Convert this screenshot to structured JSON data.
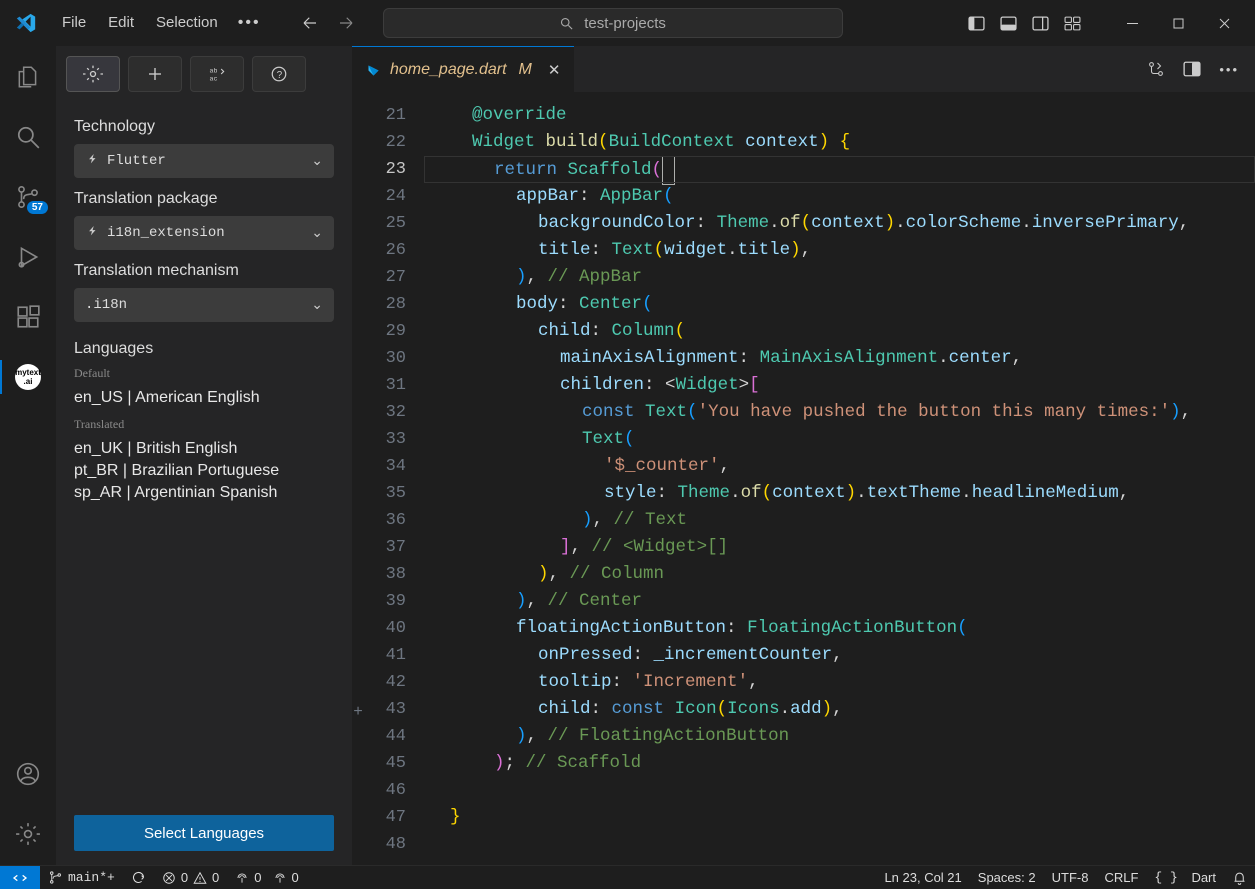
{
  "titlebar": {
    "menus": [
      "File",
      "Edit",
      "Selection"
    ],
    "search_placeholder": "test-projects"
  },
  "activitybar": {
    "scm_badge": "57",
    "mytext_label": "mytext\n.ai"
  },
  "sidebar": {
    "sections": {
      "technology_label": "Technology",
      "technology_value": "Flutter",
      "package_label": "Translation package",
      "package_value": "i18n_extension",
      "mechanism_label": "Translation mechanism",
      "mechanism_value": ".i18n"
    },
    "languages_header": "Languages",
    "default_label": "Default",
    "default_items": [
      "en_US | American English"
    ],
    "translated_label": "Translated",
    "translated_items": [
      "en_UK | British English",
      "pt_BR | Brazilian Portuguese",
      "sp_AR | Argentinian Spanish"
    ],
    "select_button": "Select Languages"
  },
  "editor": {
    "tab_filename": "home_page.dart",
    "tab_modified": "M",
    "line_start": 21,
    "line_end": 48,
    "current_line": 23,
    "decorated_plus_line": 43,
    "code_lines": [
      [
        [
          "iw",
          2
        ],
        [
          "tk-green",
          "@override"
        ]
      ],
      [
        [
          "iw",
          2
        ],
        [
          "tk-type",
          "Widget"
        ],
        [
          "tk-white",
          " "
        ],
        [
          "tk-func",
          "build"
        ],
        [
          "tk-paren-y",
          "("
        ],
        [
          "tk-type",
          "BuildContext"
        ],
        [
          "tk-white",
          " "
        ],
        [
          "tk-var",
          "context"
        ],
        [
          "tk-paren-y",
          ")"
        ],
        [
          "tk-white",
          " "
        ],
        [
          "tk-paren-y",
          "{"
        ]
      ],
      [
        [
          "iw",
          3
        ],
        [
          "tk-keyword",
          "return"
        ],
        [
          "tk-white",
          " "
        ],
        [
          "tk-type",
          "Scaffold"
        ],
        [
          "tk-paren-p",
          "("
        ],
        [
          "cursor",
          ""
        ]
      ],
      [
        [
          "iw",
          4
        ],
        [
          "tk-var",
          "appBar"
        ],
        [
          "tk-punc",
          ":"
        ],
        [
          "tk-white",
          " "
        ],
        [
          "tk-type",
          "AppBar"
        ],
        [
          "tk-paren-b",
          "("
        ]
      ],
      [
        [
          "iw",
          5
        ],
        [
          "tk-var",
          "backgroundColor"
        ],
        [
          "tk-punc",
          ":"
        ],
        [
          "tk-white",
          " "
        ],
        [
          "tk-type",
          "Theme"
        ],
        [
          "tk-punc",
          "."
        ],
        [
          "tk-func",
          "of"
        ],
        [
          "tk-paren-y",
          "("
        ],
        [
          "tk-var",
          "context"
        ],
        [
          "tk-paren-y",
          ")"
        ],
        [
          "tk-punc",
          "."
        ],
        [
          "tk-var",
          "colorScheme"
        ],
        [
          "tk-punc",
          "."
        ],
        [
          "tk-var",
          "inversePrimary"
        ],
        [
          "tk-punc",
          ","
        ]
      ],
      [
        [
          "iw",
          5
        ],
        [
          "tk-var",
          "title"
        ],
        [
          "tk-punc",
          ":"
        ],
        [
          "tk-white",
          " "
        ],
        [
          "tk-type",
          "Text"
        ],
        [
          "tk-paren-y",
          "("
        ],
        [
          "tk-var",
          "widget"
        ],
        [
          "tk-punc",
          "."
        ],
        [
          "tk-var",
          "title"
        ],
        [
          "tk-paren-y",
          ")"
        ],
        [
          "tk-punc",
          ","
        ]
      ],
      [
        [
          "iw",
          4
        ],
        [
          "tk-paren-b",
          ")"
        ],
        [
          "tk-punc",
          ","
        ],
        [
          "tk-white",
          " "
        ],
        [
          "tk-comment",
          "// AppBar"
        ]
      ],
      [
        [
          "iw",
          4
        ],
        [
          "tk-var",
          "body"
        ],
        [
          "tk-punc",
          ":"
        ],
        [
          "tk-white",
          " "
        ],
        [
          "tk-type",
          "Center"
        ],
        [
          "tk-paren-b",
          "("
        ]
      ],
      [
        [
          "iw",
          5
        ],
        [
          "tk-var",
          "child"
        ],
        [
          "tk-punc",
          ":"
        ],
        [
          "tk-white",
          " "
        ],
        [
          "tk-type",
          "Column"
        ],
        [
          "tk-paren-y",
          "("
        ]
      ],
      [
        [
          "iw",
          6
        ],
        [
          "tk-var",
          "mainAxisAlignment"
        ],
        [
          "tk-punc",
          ":"
        ],
        [
          "tk-white",
          " "
        ],
        [
          "tk-type",
          "MainAxisAlignment"
        ],
        [
          "tk-punc",
          "."
        ],
        [
          "tk-var",
          "center"
        ],
        [
          "tk-punc",
          ","
        ]
      ],
      [
        [
          "iw",
          6
        ],
        [
          "tk-var",
          "children"
        ],
        [
          "tk-punc",
          ":"
        ],
        [
          "tk-white",
          " "
        ],
        [
          "tk-punc",
          "<"
        ],
        [
          "tk-type",
          "Widget"
        ],
        [
          "tk-punc",
          ">"
        ],
        [
          "tk-paren-p",
          "["
        ]
      ],
      [
        [
          "iw",
          7
        ],
        [
          "tk-keyword",
          "const"
        ],
        [
          "tk-white",
          " "
        ],
        [
          "tk-type",
          "Text"
        ],
        [
          "tk-paren-b",
          "("
        ],
        [
          "tk-string",
          "'You have pushed the button this many times:'"
        ],
        [
          "tk-paren-b",
          ")"
        ],
        [
          "tk-punc",
          ","
        ]
      ],
      [
        [
          "iw",
          7
        ],
        [
          "tk-type",
          "Text"
        ],
        [
          "tk-paren-b",
          "("
        ]
      ],
      [
        [
          "iw",
          8
        ],
        [
          "tk-string",
          "'$_counter'"
        ],
        [
          "tk-punc",
          ","
        ]
      ],
      [
        [
          "iw",
          8
        ],
        [
          "tk-var",
          "style"
        ],
        [
          "tk-punc",
          ":"
        ],
        [
          "tk-white",
          " "
        ],
        [
          "tk-type",
          "Theme"
        ],
        [
          "tk-punc",
          "."
        ],
        [
          "tk-func",
          "of"
        ],
        [
          "tk-paren-y",
          "("
        ],
        [
          "tk-var",
          "context"
        ],
        [
          "tk-paren-y",
          ")"
        ],
        [
          "tk-punc",
          "."
        ],
        [
          "tk-var",
          "textTheme"
        ],
        [
          "tk-punc",
          "."
        ],
        [
          "tk-var",
          "headlineMedium"
        ],
        [
          "tk-punc",
          ","
        ]
      ],
      [
        [
          "iw",
          7
        ],
        [
          "tk-paren-b",
          ")"
        ],
        [
          "tk-punc",
          ","
        ],
        [
          "tk-white",
          " "
        ],
        [
          "tk-comment",
          "// Text"
        ]
      ],
      [
        [
          "iw",
          6
        ],
        [
          "tk-paren-p",
          "]"
        ],
        [
          "tk-punc",
          ","
        ],
        [
          "tk-white",
          " "
        ],
        [
          "tk-comment",
          "// <Widget>[]"
        ]
      ],
      [
        [
          "iw",
          5
        ],
        [
          "tk-paren-y",
          ")"
        ],
        [
          "tk-punc",
          ","
        ],
        [
          "tk-white",
          " "
        ],
        [
          "tk-comment",
          "// Column"
        ]
      ],
      [
        [
          "iw",
          4
        ],
        [
          "tk-paren-b",
          ")"
        ],
        [
          "tk-punc",
          ","
        ],
        [
          "tk-white",
          " "
        ],
        [
          "tk-comment",
          "// Center"
        ]
      ],
      [
        [
          "iw",
          4
        ],
        [
          "tk-var",
          "floatingActionButton"
        ],
        [
          "tk-punc",
          ":"
        ],
        [
          "tk-white",
          " "
        ],
        [
          "tk-type",
          "FloatingActionButton"
        ],
        [
          "tk-paren-b",
          "("
        ]
      ],
      [
        [
          "iw",
          5
        ],
        [
          "tk-var",
          "onPressed"
        ],
        [
          "tk-punc",
          ":"
        ],
        [
          "tk-white",
          " "
        ],
        [
          "tk-var",
          "_incrementCounter"
        ],
        [
          "tk-punc",
          ","
        ]
      ],
      [
        [
          "iw",
          5
        ],
        [
          "tk-var",
          "tooltip"
        ],
        [
          "tk-punc",
          ":"
        ],
        [
          "tk-white",
          " "
        ],
        [
          "tk-string",
          "'Increment'"
        ],
        [
          "tk-punc",
          ","
        ]
      ],
      [
        [
          "iw",
          5
        ],
        [
          "tk-var",
          "child"
        ],
        [
          "tk-punc",
          ":"
        ],
        [
          "tk-white",
          " "
        ],
        [
          "tk-keyword",
          "const"
        ],
        [
          "tk-white",
          " "
        ],
        [
          "tk-type",
          "Icon"
        ],
        [
          "tk-paren-y",
          "("
        ],
        [
          "tk-type",
          "Icons"
        ],
        [
          "tk-punc",
          "."
        ],
        [
          "tk-var",
          "add"
        ],
        [
          "tk-paren-y",
          ")"
        ],
        [
          "tk-punc",
          ","
        ]
      ],
      [
        [
          "iw",
          4
        ],
        [
          "tk-paren-b",
          ")"
        ],
        [
          "tk-punc",
          ","
        ],
        [
          "tk-white",
          " "
        ],
        [
          "tk-comment",
          "// FloatingActionButton"
        ]
      ],
      [
        [
          "iw",
          3
        ],
        [
          "tk-paren-p",
          ")"
        ],
        [
          "tk-punc",
          ";"
        ],
        [
          "tk-white",
          " "
        ],
        [
          "tk-comment",
          "// Scaffold"
        ]
      ],
      [
        [
          "iw",
          2
        ]
      ],
      [
        [
          "iw",
          1
        ],
        [
          "tk-paren-y",
          "}"
        ]
      ],
      [
        [
          "iw",
          0
        ]
      ]
    ]
  },
  "statusbar": {
    "branch": "main*+",
    "errors": "0",
    "warnings": "0",
    "ports": "0",
    "ports2": "0",
    "cursor": "Ln 23, Col 21",
    "spaces": "Spaces: 2",
    "encoding": "UTF-8",
    "eol": "CRLF",
    "lang": "Dart"
  }
}
